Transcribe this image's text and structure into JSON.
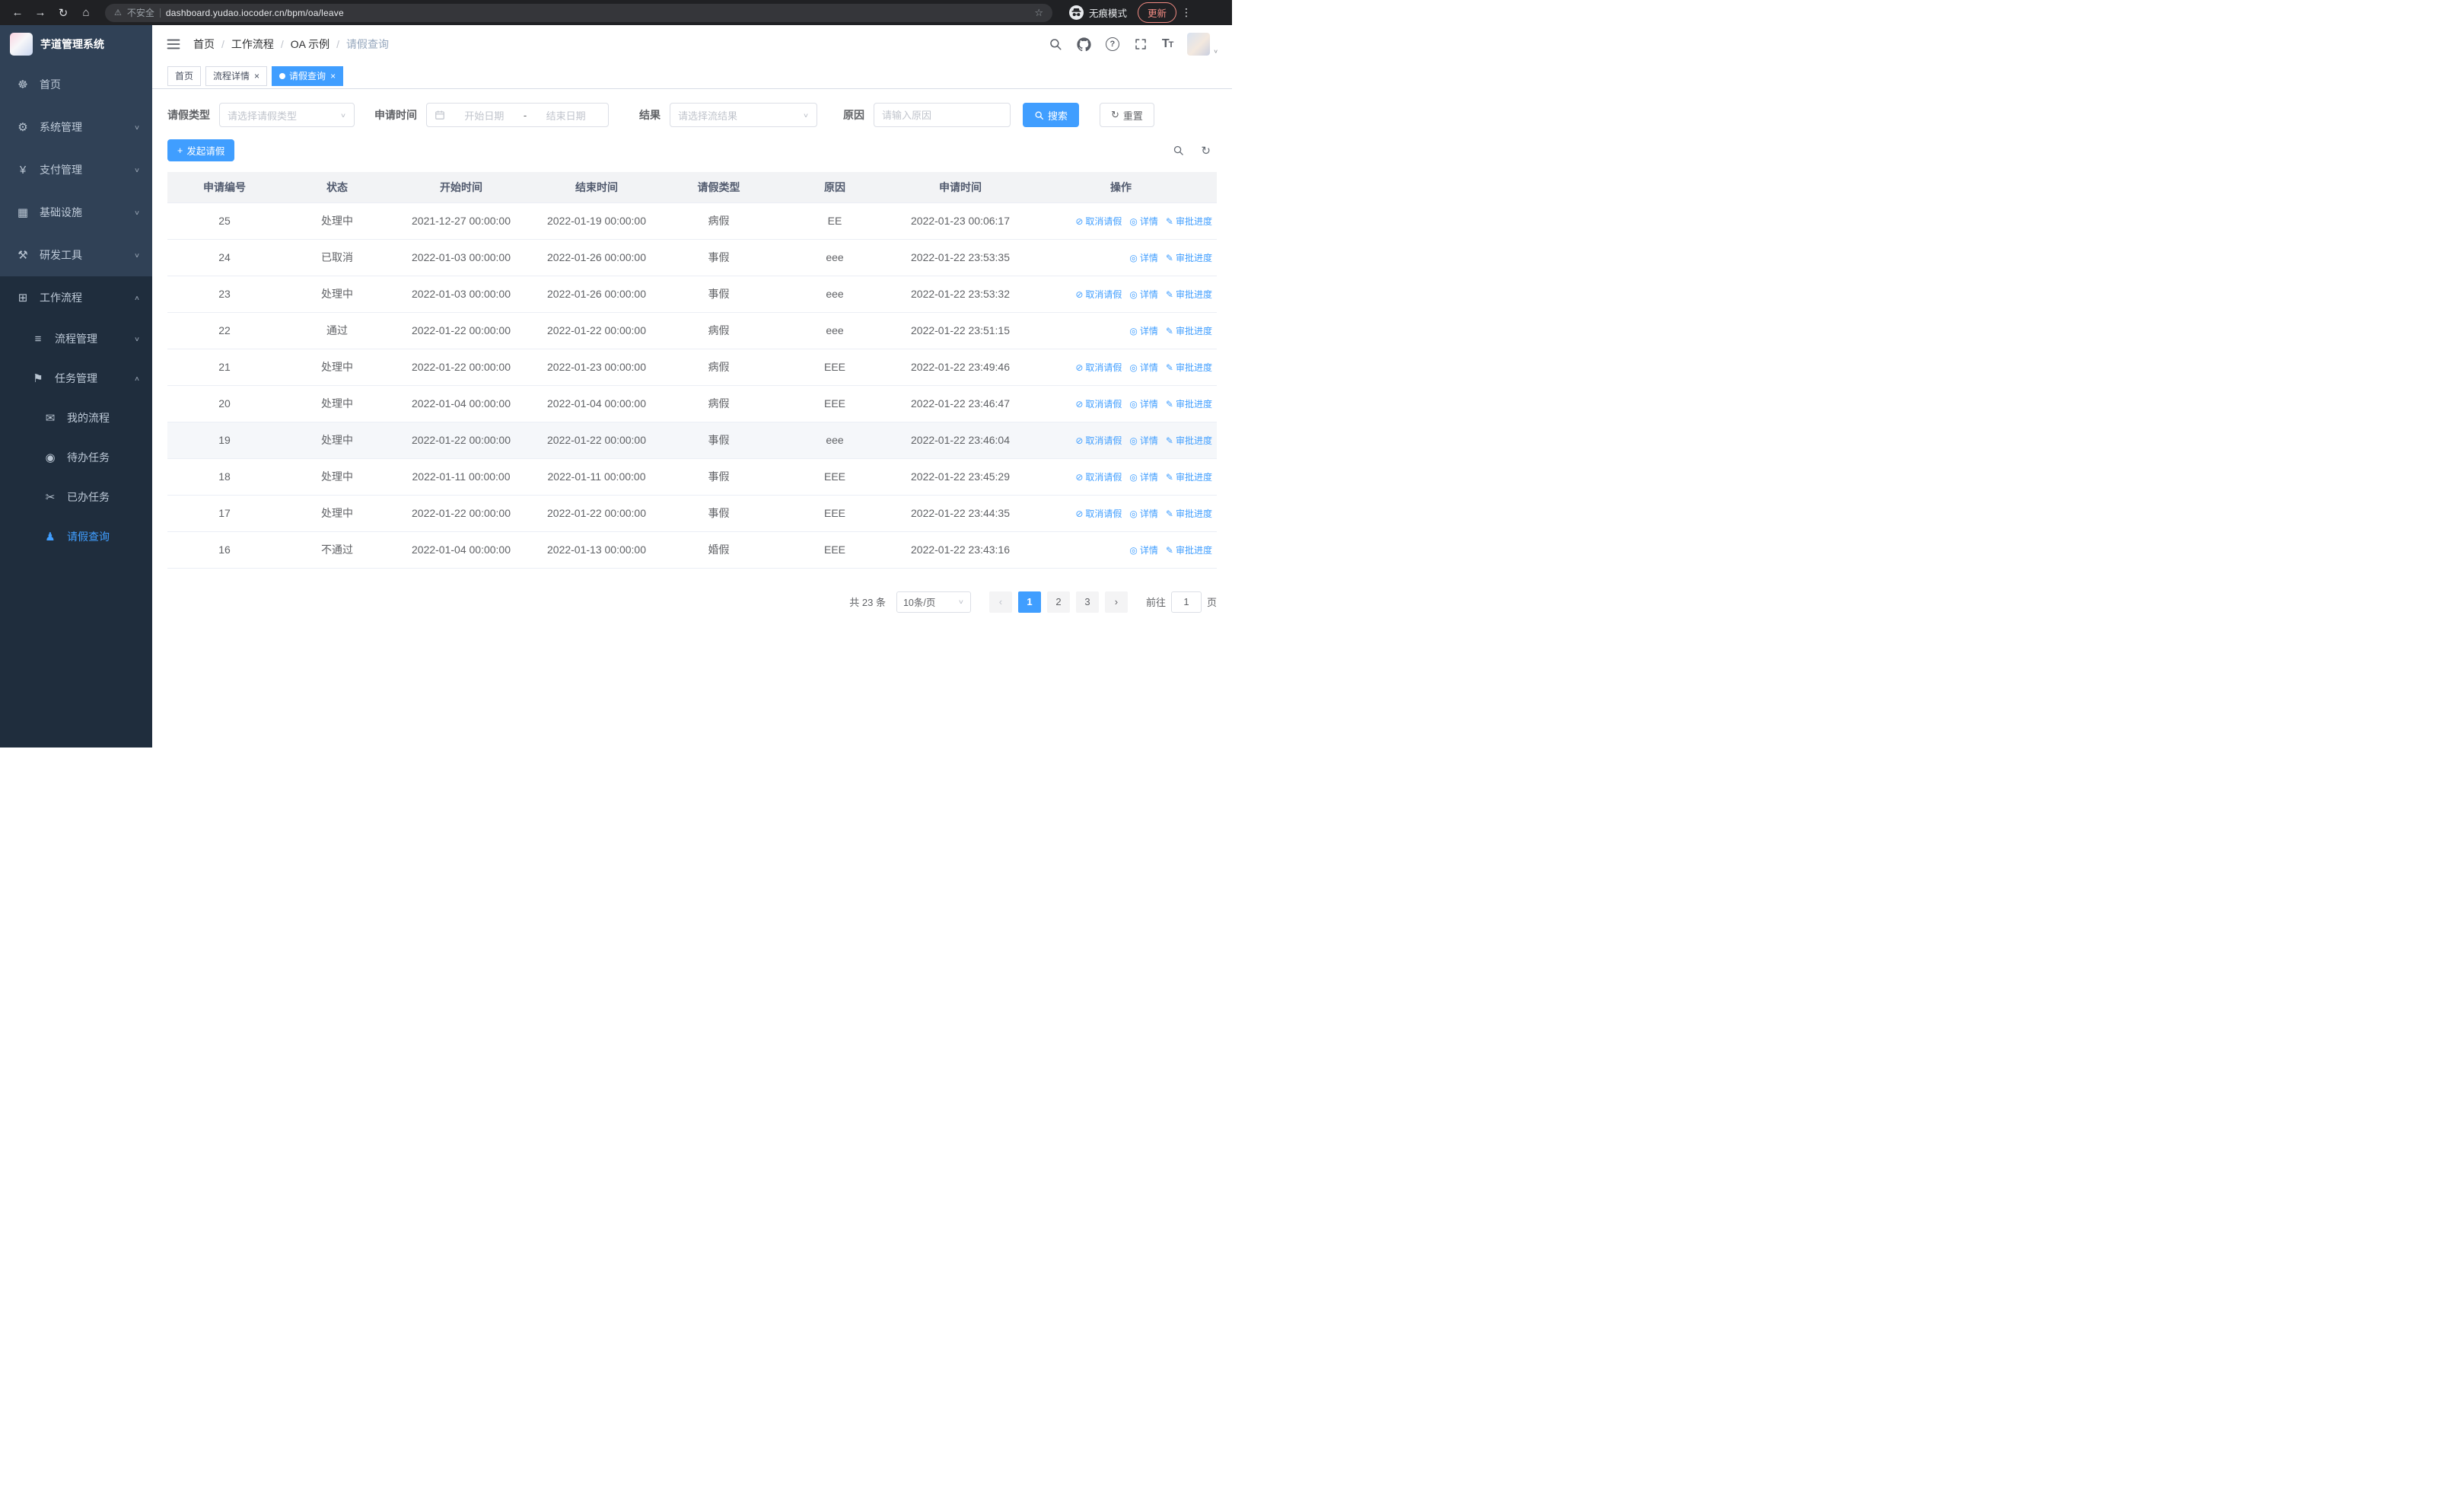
{
  "colors": {
    "accent": "#409eff",
    "sidebar_bg": "#304156",
    "submenu_bg": "#1f2d3d",
    "chrome_bg": "#202124",
    "update_chip": "#f28b82",
    "table_header_bg": "#f2f3f5"
  },
  "icons": {
    "back": "←",
    "forward": "→",
    "reload": "↻",
    "home": "⌂",
    "warning": "⚠",
    "star": "☆",
    "menu_dots": "⋮",
    "caret_down": "∨",
    "caret_up": "∧",
    "close": "×",
    "plus": "+",
    "refresh": "↻",
    "ops_cancel": "⊘",
    "ops_detail": "◎",
    "ops_progress": "✎",
    "pager_prev": "‹",
    "pager_next": "›"
  },
  "browser": {
    "security_label": "不安全",
    "url": "dashboard.yudao.iocoder.cn/bpm/oa/leave",
    "incognito_label": "无痕模式",
    "update_label": "更新"
  },
  "sidebar": {
    "logo_title": "芋道管理系统",
    "items": [
      {
        "label": "首页",
        "icon": "☸"
      },
      {
        "label": "系统管理",
        "icon": "⚙"
      },
      {
        "label": "支付管理",
        "icon": "¥"
      },
      {
        "label": "基础设施",
        "icon": "▦"
      },
      {
        "label": "研发工具",
        "icon": "⚒"
      },
      {
        "label": "工作流程",
        "icon": "⊞"
      }
    ],
    "submenu": [
      {
        "label": "流程管理",
        "icon": "≡"
      },
      {
        "label": "任务管理",
        "icon": "⚑"
      }
    ],
    "task_children": [
      {
        "label": "我的流程",
        "icon": "✉"
      },
      {
        "label": "待办任务",
        "icon": "◉"
      },
      {
        "label": "已办任务",
        "icon": "✂"
      },
      {
        "label": "请假查询",
        "icon": "♟"
      }
    ]
  },
  "header": {
    "breadcrumb": [
      "首页",
      "工作流程",
      "OA 示例",
      "请假查询"
    ]
  },
  "tabs": [
    {
      "label": "首页"
    },
    {
      "label": "流程详情"
    },
    {
      "label": "请假查询"
    }
  ],
  "filters": {
    "leave_type_label": "请假类型",
    "leave_type_placeholder": "请选择请假类型",
    "apply_time_label": "申请时间",
    "start_date_placeholder": "开始日期",
    "range_separator": "-",
    "end_date_placeholder": "结束日期",
    "result_label": "结果",
    "result_placeholder": "请选择流结果",
    "reason_label": "原因",
    "reason_placeholder": "请输入原因",
    "search_button": "搜索",
    "reset_button": "重置"
  },
  "toolbar": {
    "create_button": "发起请假"
  },
  "table": {
    "columns": [
      "申请编号",
      "状态",
      "开始时间",
      "结束时间",
      "请假类型",
      "原因",
      "申请时间",
      "操作"
    ],
    "actions": {
      "cancel": "取消请假",
      "detail": "详情",
      "progress": "审批进度"
    },
    "rows": [
      {
        "id": "25",
        "status": "处理中",
        "start": "2021-12-27 00:00:00",
        "end": "2022-01-19 00:00:00",
        "type": "病假",
        "reason": "EE",
        "applied": "2022-01-23 00:06:17",
        "cancellable": true,
        "highlighted": false
      },
      {
        "id": "24",
        "status": "已取消",
        "start": "2022-01-03 00:00:00",
        "end": "2022-01-26 00:00:00",
        "type": "事假",
        "reason": "eee",
        "applied": "2022-01-22 23:53:35",
        "cancellable": false,
        "highlighted": false
      },
      {
        "id": "23",
        "status": "处理中",
        "start": "2022-01-03 00:00:00",
        "end": "2022-01-26 00:00:00",
        "type": "事假",
        "reason": "eee",
        "applied": "2022-01-22 23:53:32",
        "cancellable": true,
        "highlighted": false
      },
      {
        "id": "22",
        "status": "通过",
        "start": "2022-01-22 00:00:00",
        "end": "2022-01-22 00:00:00",
        "type": "病假",
        "reason": "eee",
        "applied": "2022-01-22 23:51:15",
        "cancellable": false,
        "highlighted": false
      },
      {
        "id": "21",
        "status": "处理中",
        "start": "2022-01-22 00:00:00",
        "end": "2022-01-23 00:00:00",
        "type": "病假",
        "reason": "EEE",
        "applied": "2022-01-22 23:49:46",
        "cancellable": true,
        "highlighted": false
      },
      {
        "id": "20",
        "status": "处理中",
        "start": "2022-01-04 00:00:00",
        "end": "2022-01-04 00:00:00",
        "type": "病假",
        "reason": "EEE",
        "applied": "2022-01-22 23:46:47",
        "cancellable": true,
        "highlighted": false
      },
      {
        "id": "19",
        "status": "处理中",
        "start": "2022-01-22 00:00:00",
        "end": "2022-01-22 00:00:00",
        "type": "事假",
        "reason": "eee",
        "applied": "2022-01-22 23:46:04",
        "cancellable": true,
        "highlighted": true
      },
      {
        "id": "18",
        "status": "处理中",
        "start": "2022-01-11 00:00:00",
        "end": "2022-01-11 00:00:00",
        "type": "事假",
        "reason": "EEE",
        "applied": "2022-01-22 23:45:29",
        "cancellable": true,
        "highlighted": false
      },
      {
        "id": "17",
        "status": "处理中",
        "start": "2022-01-22 00:00:00",
        "end": "2022-01-22 00:00:00",
        "type": "事假",
        "reason": "EEE",
        "applied": "2022-01-22 23:44:35",
        "cancellable": true,
        "highlighted": false
      },
      {
        "id": "16",
        "status": "不通过",
        "start": "2022-01-04 00:00:00",
        "end": "2022-01-13 00:00:00",
        "type": "婚假",
        "reason": "EEE",
        "applied": "2022-01-22 23:43:16",
        "cancellable": false,
        "highlighted": false
      }
    ]
  },
  "pagination": {
    "total": "共 23 条",
    "page_size": "10条/页",
    "pages": [
      "1",
      "2",
      "3"
    ],
    "active_page": "1",
    "goto_label": "前往",
    "goto_value": "1",
    "goto_suffix": "页"
  }
}
